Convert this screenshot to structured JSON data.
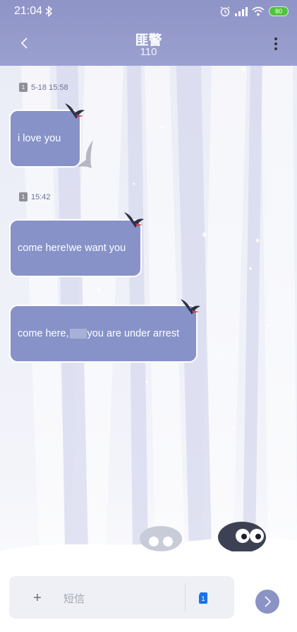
{
  "status_bar": {
    "time": "21:04",
    "battery": "80",
    "icons": [
      "bluetooth-icon",
      "alarm-icon",
      "signal-icon",
      "wifi-icon",
      "battery-icon"
    ]
  },
  "header": {
    "title": "匪警",
    "subtitle": "110",
    "back_icon": "chevron-left-icon",
    "more_icon": "more-vertical-icon"
  },
  "messages": [
    {
      "timestamp": {
        "sim": "1",
        "text": "5-18 15:58"
      },
      "text": "i love you"
    },
    {
      "timestamp": {
        "sim": "1",
        "text": "15:42"
      },
      "text": "come here!we want you"
    },
    {
      "text_before": "come here,",
      "text_after": "you are under arrest"
    }
  ],
  "composer": {
    "add_icon": "+",
    "placeholder": "短信",
    "sim_label": "1",
    "send_icon": "chevron-right-icon"
  },
  "colors": {
    "header": "#9097c9",
    "bubble": "#8792c8",
    "send_button": "#8b93c5",
    "battery": "#50c33a"
  }
}
